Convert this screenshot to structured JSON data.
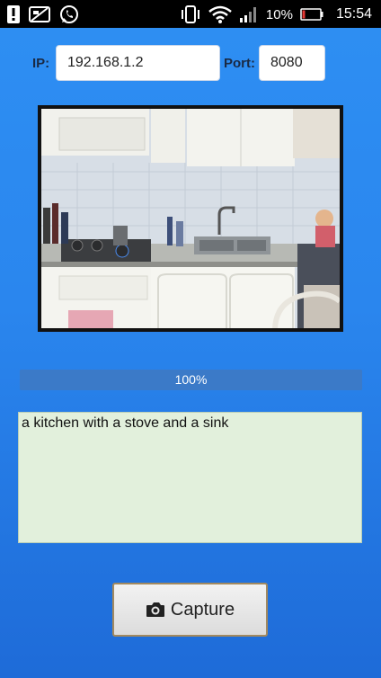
{
  "status_bar": {
    "icons_left": [
      "alert-icon",
      "no-sim-icon",
      "whatsapp-icon"
    ],
    "icons_right": [
      "vibrate-icon",
      "wifi-icon",
      "signal-icon"
    ],
    "battery": "10%",
    "time": "15:54"
  },
  "connection": {
    "ip_label": "IP:",
    "ip_value": "192.168.1.2",
    "port_label": "Port:",
    "port_value": "8080"
  },
  "progress": {
    "value": 1.0,
    "text": "100%"
  },
  "caption": {
    "text": "a kitchen with a stove and a sink"
  },
  "capture_button": {
    "label": "Capture",
    "icon": "camera-icon"
  },
  "colors": {
    "background_top": "#2e8ff3",
    "background_bottom": "#1e6bd8",
    "caption_bg": "#e2f0dc",
    "progress_bar": "#3b7ac8"
  }
}
